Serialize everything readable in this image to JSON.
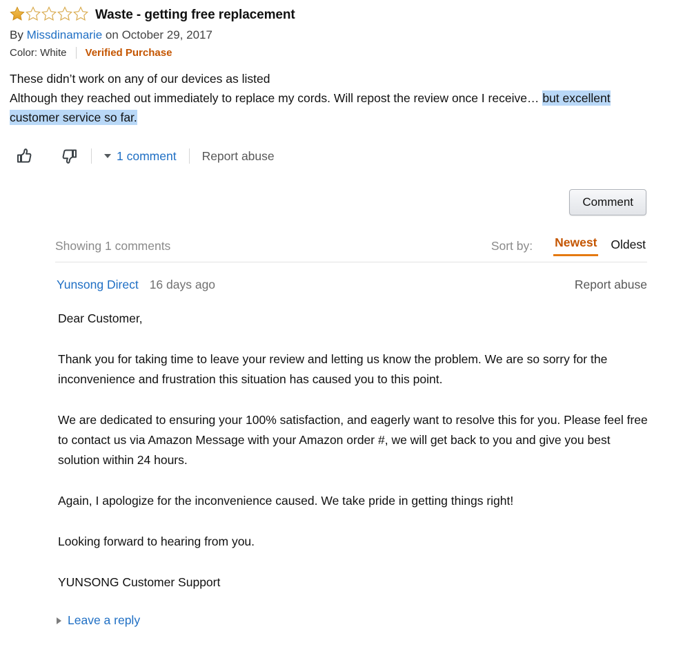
{
  "review": {
    "rating": 1,
    "max_rating": 5,
    "star_filled_color": "#e9a530",
    "star_empty_color": "#d6a13a",
    "title": "Waste - getting free replacement",
    "by_label": "By",
    "author": "Missdinamarie",
    "on_label": "on",
    "date": "October 29, 2017",
    "color_attribute": "Color: White",
    "verified_purchase": "Verified Purchase",
    "verified_color": "#c45500",
    "body_line_1": "These didn’t work on any of our devices as listed",
    "body_line_2_plain": "Although they reached out immediately to replace my cords. Will repost the review once I receive… ",
    "body_line_2_highlighted": "but excellent customer service so far.",
    "highlight_color": "#b9d8f7"
  },
  "actions": {
    "thumbs_up_icon": "thumbs-up-icon",
    "thumbs_down_icon": "thumbs-down-icon",
    "comment_count": "1 comment",
    "report_abuse": "Report abuse",
    "comment_button": "Comment"
  },
  "comments_section": {
    "showing": "Showing 1 comments",
    "sort_by_label": "Sort by:",
    "sort_options": [
      {
        "label": "Newest",
        "active": true
      },
      {
        "label": "Oldest",
        "active": false
      }
    ],
    "active_color": "#c45500",
    "comment": {
      "author": "Yunsong Direct",
      "age": "16 days ago",
      "report_abuse": "Report abuse",
      "paragraphs": [
        "Dear Customer,",
        "Thank you for taking time to leave your review and letting us know the problem. We are so sorry for the inconvenience and frustration this situation has caused you to this point.",
        "We are dedicated to ensuring your 100% satisfaction, and eagerly want to resolve this for you. Please feel free to contact us via Amazon Message with your Amazon order #, we will get back to you and give you best solution within 24 hours.",
        "Again, I apologize for the inconvenience caused. We take pride in getting things right!",
        "Looking forward to hearing from you.",
        "YUNSONG Customer Support"
      ],
      "reply_link": "Leave a reply"
    }
  }
}
